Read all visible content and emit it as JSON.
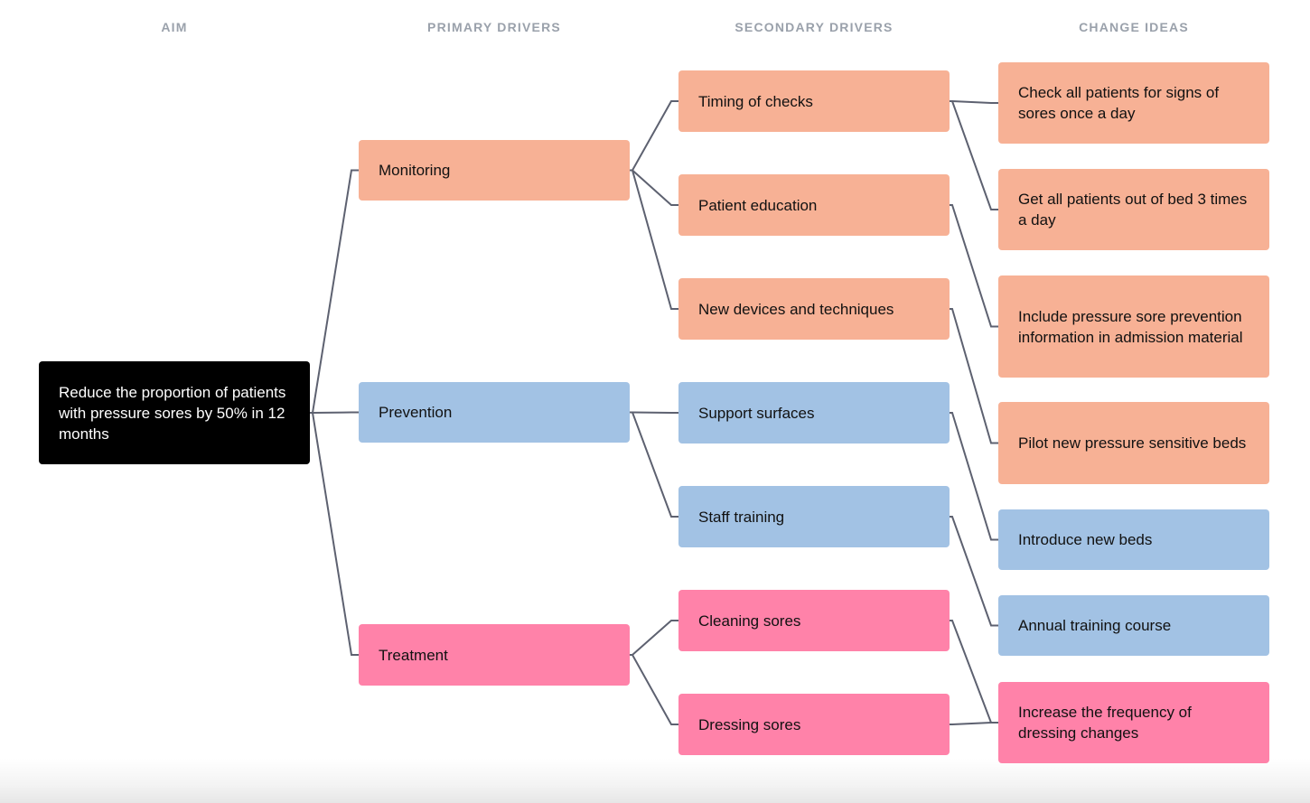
{
  "headers": [
    "AIM",
    "PRIMARY DRIVERS",
    "SECONDARY DRIVERS",
    "CHANGE IDEAS"
  ],
  "colors": {
    "monitoring": "#f7b195",
    "prevention": "#a2c2e4",
    "treatment": "#ff82a9",
    "aim": "#000000",
    "connector": "#5d6170",
    "header_text": "#9aa1ab"
  },
  "aim": {
    "id": "aim",
    "text": "Reduce the proportion of patients with pressure sores by 50% in 12 months"
  },
  "primary_drivers": [
    {
      "id": "p-monitoring",
      "text": "Monitoring",
      "group": "monitoring"
    },
    {
      "id": "p-prevention",
      "text": "Prevention",
      "group": "prevention"
    },
    {
      "id": "p-treatment",
      "text": "Treatment",
      "group": "treatment"
    }
  ],
  "secondary_drivers": [
    {
      "id": "s-timing",
      "text": "Timing of checks",
      "group": "monitoring",
      "parent": "p-monitoring"
    },
    {
      "id": "s-education",
      "text": "Patient education",
      "group": "monitoring",
      "parent": "p-monitoring"
    },
    {
      "id": "s-devices",
      "text": "New devices and techniques",
      "group": "monitoring",
      "parent": "p-monitoring"
    },
    {
      "id": "s-support",
      "text": "Support surfaces",
      "group": "prevention",
      "parent": "p-prevention"
    },
    {
      "id": "s-staff",
      "text": "Staff training",
      "group": "prevention",
      "parent": "p-prevention"
    },
    {
      "id": "s-cleaning",
      "text": "Cleaning sores",
      "group": "treatment",
      "parent": "p-treatment"
    },
    {
      "id": "s-dressing",
      "text": "Dressing sores",
      "group": "treatment",
      "parent": "p-treatment"
    }
  ],
  "change_ideas": [
    {
      "id": "c-check",
      "text": "Check all patients for signs of sores once a day",
      "group": "monitoring",
      "parents": [
        "s-timing"
      ]
    },
    {
      "id": "c-bed",
      "text": "Get all patients out of bed 3 times a day",
      "group": "monitoring",
      "parents": [
        "s-timing"
      ]
    },
    {
      "id": "c-include",
      "text": "Include pressure sore prevention information in admission material",
      "group": "monitoring",
      "parents": [
        "s-education"
      ]
    },
    {
      "id": "c-pilot",
      "text": "Pilot new pressure sensitive beds",
      "group": "monitoring",
      "parents": [
        "s-devices"
      ]
    },
    {
      "id": "c-introduce",
      "text": "Introduce new beds",
      "group": "prevention",
      "parents": [
        "s-support"
      ]
    },
    {
      "id": "c-annual",
      "text": "Annual training course",
      "group": "prevention",
      "parents": [
        "s-staff"
      ]
    },
    {
      "id": "c-increase",
      "text": "Increase the frequency of dressing changes",
      "group": "treatment",
      "parents": [
        "s-cleaning",
        "s-dressing"
      ]
    }
  ]
}
